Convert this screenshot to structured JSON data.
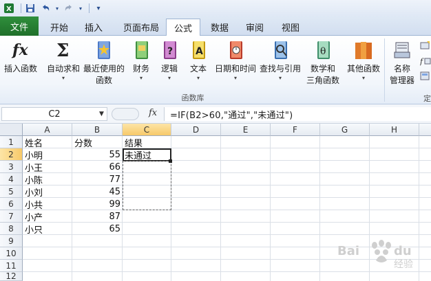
{
  "tabs": [
    "文件",
    "开始",
    "插入",
    "页面布局",
    "公式",
    "数据",
    "审阅",
    "视图"
  ],
  "active_tab": "公式",
  "ribbon": {
    "insert_function": "插入函数",
    "autosum": "自动求和",
    "recent": [
      "最近使用的",
      "函数"
    ],
    "financial": "财务",
    "logical": "逻辑",
    "text": "文本",
    "datetime": "日期和时间",
    "lookup": "查找与引用",
    "math": [
      "数学和",
      "三角函数"
    ],
    "more": "其他函数",
    "name_manager": [
      "名称",
      "管理器"
    ],
    "group_label": "函数库",
    "cut_label": "定"
  },
  "formula_bar": {
    "name_box": "C2",
    "fx": "fx",
    "formula": "=IF(B2>60,\"通过\",\"未通过\")"
  },
  "columns": [
    "A",
    "B",
    "C",
    "D",
    "E",
    "F",
    "G",
    "H"
  ],
  "rows": [
    "1",
    "2",
    "3",
    "4",
    "5",
    "6",
    "7",
    "8",
    "9",
    "10",
    "11",
    "12"
  ],
  "sheet": {
    "headers": {
      "a1": "姓名",
      "b1": "分数",
      "c1": "结果"
    },
    "names": [
      "小明",
      "小王",
      "小陈",
      "小刘",
      "小共",
      "小产",
      "小只"
    ],
    "scores": [
      "55",
      "66",
      "77",
      "45",
      "99",
      "87",
      "65"
    ],
    "c2": "未通过"
  },
  "colors": {
    "file_tab": "#2f8f3c",
    "selection_header": "#f7c96a"
  },
  "watermark_text": "Bai du 经验"
}
